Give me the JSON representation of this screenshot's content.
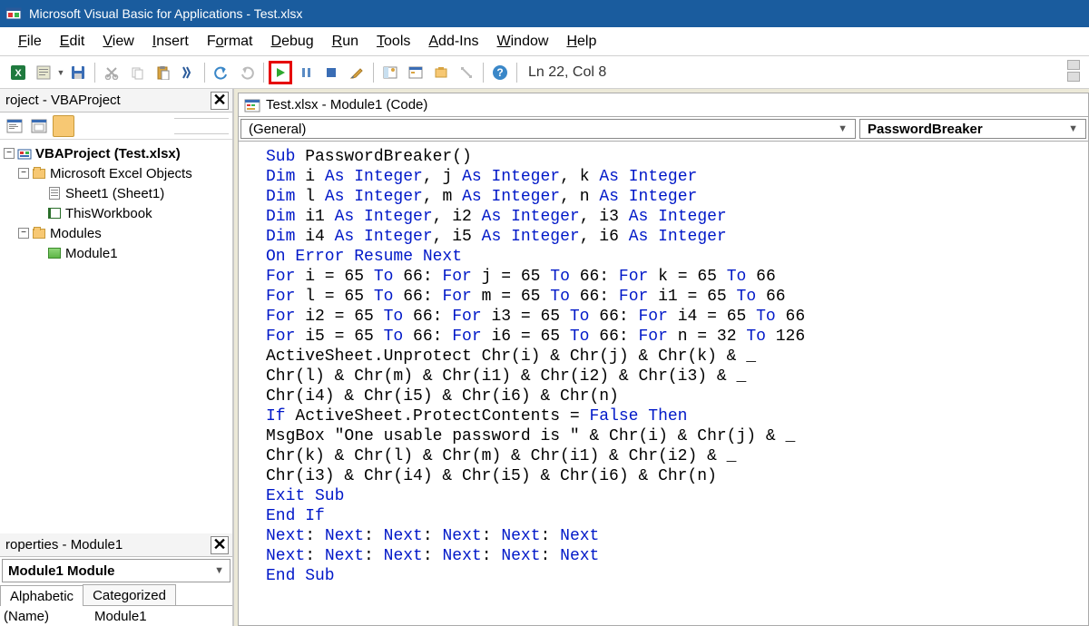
{
  "window": {
    "title": "Microsoft Visual Basic for Applications - Test.xlsx"
  },
  "menus": [
    "File",
    "Edit",
    "View",
    "Insert",
    "Format",
    "Debug",
    "Run",
    "Tools",
    "Add-Ins",
    "Window",
    "Help"
  ],
  "status": {
    "cursor": "Ln 22, Col 8"
  },
  "project_panel": {
    "title": "roject - VBAProject",
    "root": "VBAProject (Test.xlsx)",
    "excel_objects": "Microsoft Excel Objects",
    "sheet1": "Sheet1 (Sheet1)",
    "thisworkbook": "ThisWorkbook",
    "modules": "Modules",
    "module1": "Module1"
  },
  "properties_panel": {
    "title": "roperties - Module1",
    "selector": "Module1 Module",
    "tab_alpha": "Alphabetic",
    "tab_cat": "Categorized",
    "row_name": "(Name)",
    "row_val": "Module1"
  },
  "code_window": {
    "title": "Test.xlsx - Module1 (Code)",
    "dd_left": "(General)",
    "dd_right": "PasswordBreaker"
  },
  "code": {
    "l1a": "Sub",
    "l1b": " PasswordBreaker()",
    "l2a": "Dim",
    "l2b": " i ",
    "l2c": "As Integer",
    "l2d": ", j ",
    "l2e": "As Integer",
    "l2f": ", k ",
    "l2g": "As Integer",
    "l3a": "Dim",
    "l3b": " l ",
    "l3c": "As Integer",
    "l3d": ", m ",
    "l3e": "As Integer",
    "l3f": ", n ",
    "l3g": "As Integer",
    "l4a": "Dim",
    "l4b": " i1 ",
    "l4c": "As Integer",
    "l4d": ", i2 ",
    "l4e": "As Integer",
    "l4f": ", i3 ",
    "l4g": "As Integer",
    "l5a": "Dim",
    "l5b": " i4 ",
    "l5c": "As Integer",
    "l5d": ", i5 ",
    "l5e": "As Integer",
    "l5f": ", i6 ",
    "l5g": "As Integer",
    "l6": "On Error Resume Next",
    "l7a": "For",
    "l7b": " i = 65 ",
    "l7c": "To",
    "l7d": " 66: ",
    "l7e": "For",
    "l7f": " j = 65 ",
    "l7g": "To",
    "l7h": " 66: ",
    "l7i": "For",
    "l7j": " k = 65 ",
    "l7k": "To",
    "l7l": " 66",
    "l8a": "For",
    "l8b": " l = 65 ",
    "l8c": "To",
    "l8d": " 66: ",
    "l8e": "For",
    "l8f": " m = 65 ",
    "l8g": "To",
    "l8h": " 66: ",
    "l8i": "For",
    "l8j": " i1 = 65 ",
    "l8k": "To",
    "l8l": " 66",
    "l9a": "For",
    "l9b": " i2 = 65 ",
    "l9c": "To",
    "l9d": " 66: ",
    "l9e": "For",
    "l9f": " i3 = 65 ",
    "l9g": "To",
    "l9h": " 66: ",
    "l9i": "For",
    "l9j": " i4 = 65 ",
    "l9k": "To",
    "l9l": " 66",
    "l10a": "For",
    "l10b": " i5 = 65 ",
    "l10c": "To",
    "l10d": " 66: ",
    "l10e": "For",
    "l10f": " i6 = 65 ",
    "l10g": "To",
    "l10h": " 66: ",
    "l10i": "For",
    "l10j": " n = 32 ",
    "l10k": "To",
    "l10l": " 126",
    "l11": "ActiveSheet.Unprotect Chr(i) & Chr(j) & Chr(k) & _",
    "l12": "Chr(l) & Chr(m) & Chr(i1) & Chr(i2) & Chr(i3) & _",
    "l13": "Chr(i4) & Chr(i5) & Chr(i6) & Chr(n)",
    "l14a": "If",
    "l14b": " ActiveSheet.ProtectContents = ",
    "l14c": "False Then",
    "l15": "MsgBox \"One usable password is \" & Chr(i) & Chr(j) & _",
    "l16": "Chr(k) & Chr(l) & Chr(m) & Chr(i1) & Chr(i2) & _",
    "l17": "Chr(i3) & Chr(i4) & Chr(i5) & Chr(i6) & Chr(n)",
    "l18": "Exit Sub",
    "l19": "End If",
    "l20a": "Next",
    "l20b": ": ",
    "l20c": "Next",
    "l20d": ": ",
    "l20e": "Next",
    "l20f": ": ",
    "l20g": "Next",
    "l20h": ": ",
    "l20i": "Next",
    "l20j": ": ",
    "l20k": "Next",
    "l21a": "Next",
    "l21b": ": ",
    "l21c": "Next",
    "l21d": ": ",
    "l21e": "Next",
    "l21f": ": ",
    "l21g": "Next",
    "l21h": ": ",
    "l21i": "Next",
    "l21j": ": ",
    "l21k": "Next",
    "l22": "End Sub"
  }
}
